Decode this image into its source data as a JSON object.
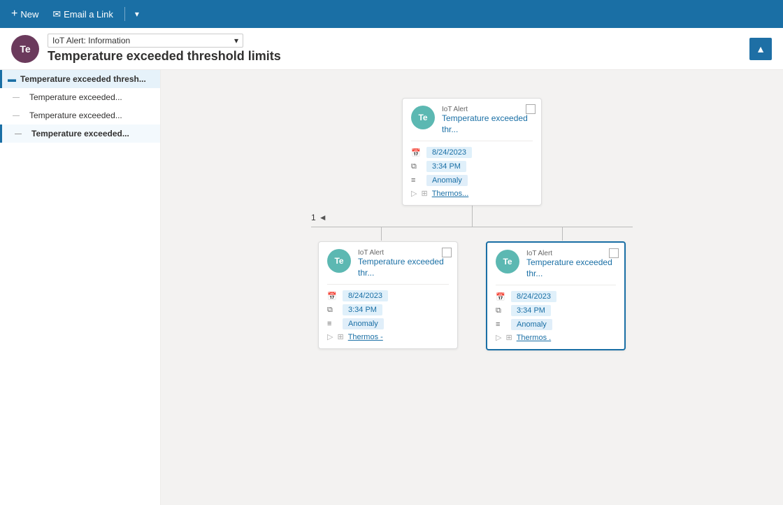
{
  "topbar": {
    "new_label": "New",
    "email_label": "Email a Link",
    "chevron": "▾"
  },
  "header": {
    "avatar_initials": "Te",
    "dropdown_value": "IoT Alert: Information",
    "title": "Temperature exceeded threshold limits",
    "collapse_icon": "▲"
  },
  "sidebar": {
    "items": [
      {
        "label": "Temperature exceeded thresh...",
        "type": "root",
        "indent": 0
      },
      {
        "label": "Temperature exceeded...",
        "type": "child",
        "indent": 1
      },
      {
        "label": "Temperature exceeded...",
        "type": "child",
        "indent": 1
      },
      {
        "label": "Temperature exceeded...",
        "type": "child active",
        "indent": 1
      }
    ]
  },
  "tree": {
    "root": {
      "avatar": "Te",
      "type": "IoT Alert",
      "title": "Temperature exceeded thr...",
      "date": "8/24/2023",
      "time": "3:34 PM",
      "category": "Anomaly",
      "thermos_link": "Thermos..."
    },
    "children": [
      {
        "avatar": "Te",
        "type": "IoT Alert",
        "title": "Temperature exceeded thr...",
        "date": "8/24/2023",
        "time": "3:34 PM",
        "category": "Anomaly",
        "thermos_link": "Thermos -"
      },
      {
        "avatar": "Te",
        "type": "IoT Alert",
        "title": "Temperature exceeded thr...",
        "date": "8/24/2023",
        "time": "3:34 PM",
        "category": "Anomaly",
        "thermos_link": "Thermos .",
        "selected": true
      }
    ]
  },
  "pagination": {
    "current_page": "1",
    "prev_icon": "◄"
  }
}
